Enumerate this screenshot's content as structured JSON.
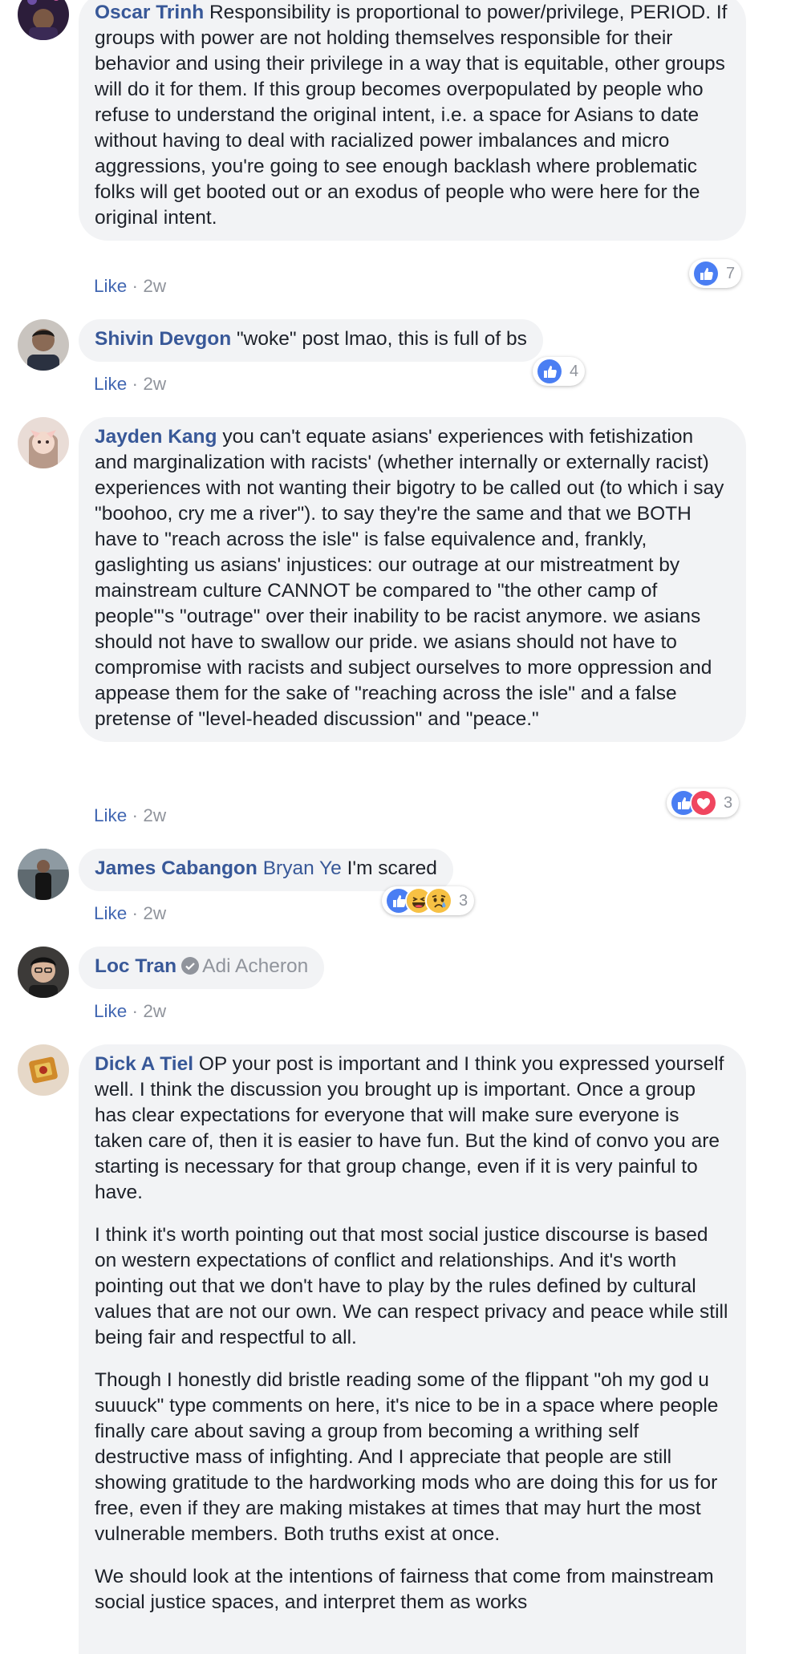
{
  "like_label": "Like",
  "separator": "·",
  "comments": [
    {
      "author": "Oscar Trinh",
      "text": "Responsibility is proportional to power/privilege, PERIOD. If groups with power are not holding themselves responsible for their behavior and using their privilege in a way that is equitable, other groups will do it for them. If this group becomes overpopulated by people who refuse to understand the original intent, i.e. a space for Asians to date without having to deal with racialized power imbalances and micro aggressions, you're going to see enough backlash where problematic folks will get booted out or an exodus of people who were here for the original intent.",
      "time": "2w",
      "reactions": [
        "like-icon"
      ],
      "reaction_count": "7"
    },
    {
      "author": "Shivin Devgon",
      "text": "\"woke\" post lmao, this is full of bs",
      "time": "2w",
      "reactions": [
        "like-icon"
      ],
      "reaction_count": "4"
    },
    {
      "author": "Jayden Kang",
      "text": "you can't equate asians' experiences with fetishization and marginalization with racists' (whether internally or externally racist) experiences with not wanting their bigotry to be called out (to which i say \"boohoo, cry me a river\"). to say they're the same and that we BOTH have to \"reach across the isle\" is false equivalence and, frankly, gaslighting us asians' injustices: our outrage at our mistreatment by mainstream culture CANNOT be compared to \"the other camp of people\"'s \"outrage\" over their inability to be racist anymore. we asians should not have to swallow our pride. we asians should not have to compromise with racists and subject ourselves to more oppression and appease them for the sake of \"reaching across the isle\" and a false pretense of \"level-headed discussion\" and \"peace.\"",
      "time": "2w",
      "reactions": [
        "like-icon",
        "love-icon"
      ],
      "reaction_count": "3"
    },
    {
      "author": "James Cabangon",
      "mention": "Bryan Ye",
      "text": "I'm scared",
      "time": "2w",
      "reactions": [
        "like-icon",
        "haha-icon",
        "sad-icon"
      ],
      "reaction_count": "3"
    },
    {
      "author": "Loc Tran",
      "badge_icon": "verified-check-icon",
      "mention": "Adi Acheron",
      "time": "2w"
    },
    {
      "author": "Dick A Tiel",
      "paragraphs": [
        "OP your post is important and I think you expressed yourself well. I think the discussion you brought up is important. Once a group has clear expectations for everyone that will make sure everyone is taken care of, then it is easier to have fun. But the kind of convo you are starting is necessary for that group change, even if it is very painful to have.",
        "I think it's worth pointing out that most social justice discourse is based on western expectations of conflict and relationships. And it's worth pointing out that we don't have to play by the rules defined by cultural values that are not our own. We can respect privacy and peace while still being fair and respectful to all.",
        "Though I honestly did bristle reading some of the flippant \"oh my god u suuuck\" type comments on here, it's nice to be in a space where people finally care about saving a group from becoming a writhing self destructive mass of infighting. And I appreciate that people are still showing gratitude to the hardworking mods who are doing this for us for free, even if they are making mistakes at times that may hurt the most vulnerable members. Both truths exist at once.",
        "We should look at the intentions of fairness that come from mainstream social justice spaces, and interpret them as works"
      ]
    }
  ],
  "colors": {
    "author_link": "#385898",
    "like_link": "#4267b2",
    "bubble_bg": "#f2f3f5",
    "meta_gray": "#90949c",
    "like_blue": "#4a7ef3",
    "love_red": "#f0465f",
    "emoji_yellow": "#f7c144"
  }
}
